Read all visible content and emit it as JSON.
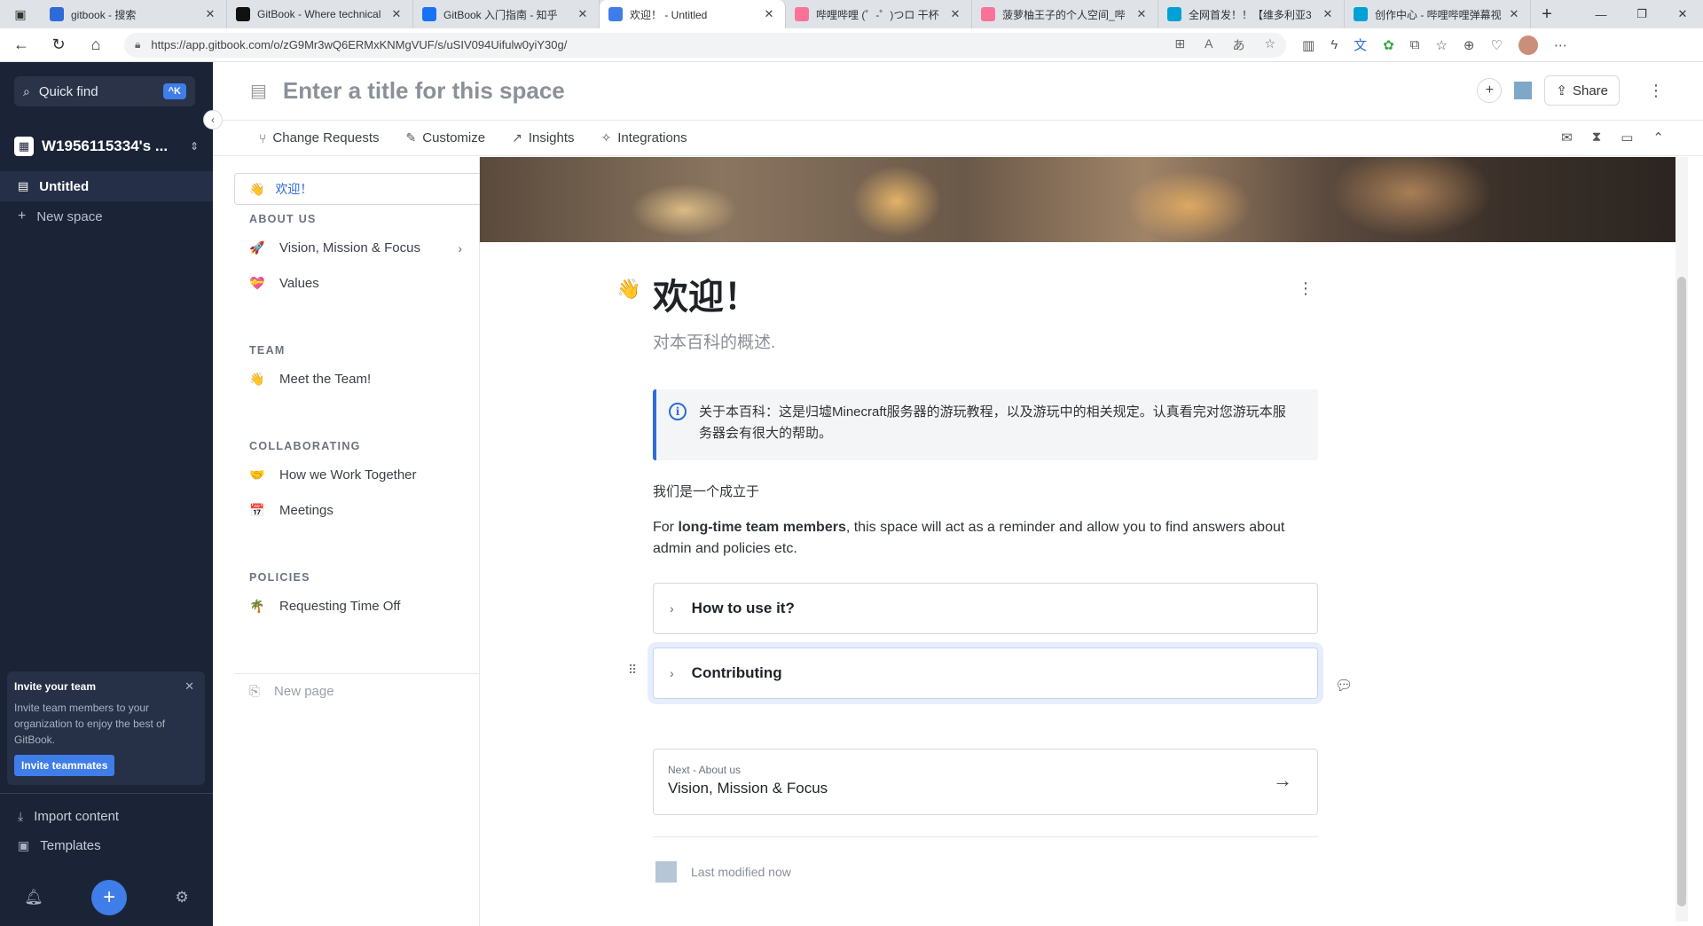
{
  "browser": {
    "tabs": [
      {
        "title": "gitbook - 搜索",
        "icon": "search-icon",
        "color": "#2f6bd8",
        "active": false
      },
      {
        "title": "GitBook - Where technical",
        "icon": "gitbook-icon",
        "color": "#111111",
        "active": false
      },
      {
        "title": "GitBook 入门指南 - 知乎",
        "icon": "zhihu-icon",
        "color": "#1772f6",
        "active": false
      },
      {
        "title": "欢迎！ - Untitled",
        "icon": "gitbook-icon",
        "color": "#3f7de8",
        "active": true
      },
      {
        "title": "哔哩哔哩 (゜-゜)つロ 干杯",
        "icon": "bilibili-icon",
        "color": "#fb7299",
        "active": false
      },
      {
        "title": "菠萝柚王子的个人空间_哔",
        "icon": "bilibili-icon",
        "color": "#fb7299",
        "active": false
      },
      {
        "title": "全网首发！！【维多利亚3",
        "icon": "bilibili-icon",
        "color": "#00a1d6",
        "active": false
      },
      {
        "title": "创作中心 - 哔哩哔哩弹幕视",
        "icon": "bilibili-icon",
        "color": "#00a1d6",
        "active": false
      }
    ],
    "url": "https://app.gitbook.com/o/zG9Mr3wQ6ERMxKNMgVUF/s/uSIV094Uifulw0yiY30g/"
  },
  "sidebar": {
    "quickfind_label": "Quick find",
    "quickfind_shortcut": "^K",
    "org_name": "W1956115334's ...",
    "space_name": "Untitled",
    "new_space_label": "New space",
    "invite": {
      "title": "Invite your team",
      "body": "Invite team members to your organization to enjoy the best of GitBook.",
      "button": "Invite teammates"
    },
    "import_label": "Import content",
    "templates_label": "Templates"
  },
  "header": {
    "title_placeholder": "Enter a title for this space",
    "share_label": "Share",
    "subnav": [
      "Change Requests",
      "Customize",
      "Insights",
      "Integrations"
    ]
  },
  "tree": {
    "active_page": {
      "emoji": "👋",
      "label": "欢迎！"
    },
    "sections": [
      {
        "title": "ABOUT US",
        "items": [
          {
            "emoji": "🚀",
            "label": "Vision, Mission & Focus",
            "has_children": true
          },
          {
            "emoji": "💝",
            "label": "Values"
          }
        ]
      },
      {
        "title": "TEAM",
        "items": [
          {
            "emoji": "👋",
            "label": "Meet the Team!"
          }
        ]
      },
      {
        "title": "COLLABORATING",
        "items": [
          {
            "emoji": "🤝",
            "label": "How we Work Together"
          },
          {
            "emoji": "📅",
            "label": "Meetings"
          }
        ]
      },
      {
        "title": "POLICIES",
        "items": [
          {
            "emoji": "🌴",
            "label": "Requesting Time Off"
          }
        ]
      }
    ],
    "new_page_label": "New page"
  },
  "page": {
    "emoji": "👋",
    "title": "欢迎！",
    "description": "对本百科的概述.",
    "hint": "关于本百科：这是归墟Minecraft服务器的游玩教程，以及游玩中的相关规定。认真看完对您游玩本服务器会有很大的帮助。",
    "para1": "我们是一个成立于",
    "para2_prefix": "For ",
    "para2_bold": "long-time team members",
    "para2_suffix": ", this space will act as a reminder and allow you to find answers about admin and policies etc.",
    "expandables": [
      "How to use it?",
      "Contributing"
    ],
    "next_label": "Next - About us",
    "next_title": "Vision, Mission & Focus",
    "last_modified": "Last modified now"
  },
  "colors": {
    "accent": "#3f7de8",
    "sidebar_bg": "#1b2436",
    "link_active": "#2f6bd8"
  }
}
